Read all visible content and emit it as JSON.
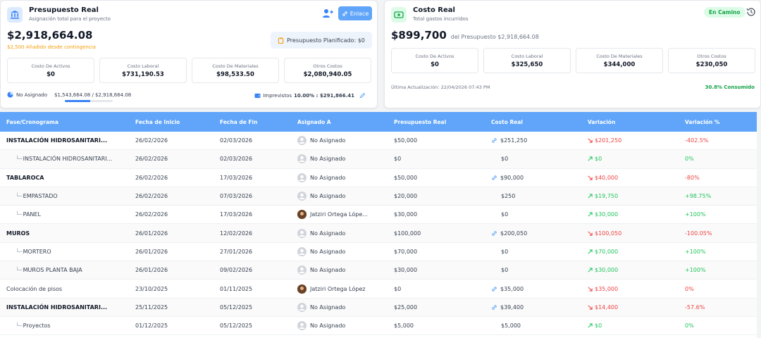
{
  "budget": {
    "title": "Presupuesto Real",
    "subtitle": "Asignación total para el proyecto",
    "amount": "$2,918,664.08",
    "contingency": "$2,500 Añadido desde contingencia",
    "link_label": "Enlace",
    "planned_label": "Presupuesto Planificado: $0",
    "stats": [
      {
        "label": "Costo De Activos",
        "value": "$0"
      },
      {
        "label": "Costo Laboral",
        "value": "$731,190.53"
      },
      {
        "label": "Costo De Materiales",
        "value": "$98,533.50"
      },
      {
        "label": "Otros Costos",
        "value": "$2,080,940.05"
      }
    ],
    "unassigned_label": "No Asignado",
    "unassigned_value": "$1,543,664.08 / $2,918,664.08",
    "unassigned_progress": 0.53,
    "imprevistos_prefix": "Imprevistos",
    "imprevistos_value": "10.00% : $291,866.41"
  },
  "cost": {
    "title": "Costo Real",
    "subtitle": "Total gastos incurridos",
    "status": "En Camino",
    "amount": "$899,700",
    "amount_note": "del Presupuesto $2,918,664.08",
    "stats": [
      {
        "label": "Costo De Activos",
        "value": "$0"
      },
      {
        "label": "Costo Laboral",
        "value": "$325,650"
      },
      {
        "label": "Costo De Materiales",
        "value": "$344,000"
      },
      {
        "label": "Otros Costos",
        "value": "$230,050"
      }
    ],
    "updated": "Última Actualización: 22/04/2026 07:43 PM",
    "consumed": "30.8% Consumido"
  },
  "table": {
    "headers": [
      "Fase/Cronograma",
      "Fecha de Inicio",
      "Fecha de Fin",
      "Asignado A",
      "Presupuesto Real",
      "Costo Real",
      "Variación",
      "Variación %"
    ],
    "rows": [
      {
        "name": "INSTALACIÓN HIDROSANITARI...",
        "start": "26/02/2026",
        "end": "02/03/2026",
        "assignee": "No Asignado",
        "budget": "$50,000",
        "cost": "$251,250",
        "variance": "$201,250",
        "variance_pct": "-402.5%"
      },
      {
        "name": "INSTALACIÓN HIDROSANITARI...",
        "start": "26/02/2026",
        "end": "02/03/2026",
        "assignee": "No Asignado",
        "budget": "$0",
        "cost": "$0",
        "variance": "$0",
        "variance_pct": "0%"
      },
      {
        "name": "TABLAROCA",
        "start": "26/02/2026",
        "end": "17/03/2026",
        "assignee": "No Asignado",
        "budget": "$50,000",
        "cost": "$90,000",
        "variance": "$40,000",
        "variance_pct": "-80%"
      },
      {
        "name": "EMPASTADO",
        "start": "26/02/2026",
        "end": "07/03/2026",
        "assignee": "No Asignado",
        "budget": "$20,000",
        "cost": "$250",
        "variance": "$19,750",
        "variance_pct": "+98.75%"
      },
      {
        "name": "PANEL",
        "start": "26/02/2026",
        "end": "17/03/2026",
        "assignee": "Jatziri Ortega Lópe...",
        "budget": "$30,000",
        "cost": "$0",
        "variance": "$30,000",
        "variance_pct": "+100%"
      },
      {
        "name": "MUROS",
        "start": "26/01/2026",
        "end": "12/02/2026",
        "assignee": "No Asignado",
        "budget": "$100,000",
        "cost": "$200,050",
        "variance": "$100,050",
        "variance_pct": "-100.05%"
      },
      {
        "name": "MORTERO",
        "start": "26/01/2026",
        "end": "27/01/2026",
        "assignee": "No Asignado",
        "budget": "$70,000",
        "cost": "$0",
        "variance": "$70,000",
        "variance_pct": "+100%"
      },
      {
        "name": "MUROS PLANTA BAJA",
        "start": "26/01/2026",
        "end": "09/02/2026",
        "assignee": "No Asignado",
        "budget": "$30,000",
        "cost": "$0",
        "variance": "$30,000",
        "variance_pct": "+100%"
      },
      {
        "name": "Colocación de pisos",
        "start": "23/10/2025",
        "end": "01/11/2025",
        "assignee": "Jatziri Ortega López",
        "budget": "$0",
        "cost": "$35,000",
        "variance": "$35,000",
        "variance_pct": "0%"
      },
      {
        "name": "INSTALACIÓN HIDROSANITARI...",
        "start": "25/11/2025",
        "end": "05/12/2025",
        "assignee": "No Asignado",
        "budget": "$25,000",
        "cost": "$39,400",
        "variance": "$14,400",
        "variance_pct": "-57.6%"
      },
      {
        "name": "Proyectos",
        "start": "01/12/2025",
        "end": "05/12/2025",
        "assignee": "No Asignado",
        "budget": "$5,000",
        "cost": "$5,000",
        "variance": "$0",
        "variance_pct": "0%"
      }
    ]
  }
}
